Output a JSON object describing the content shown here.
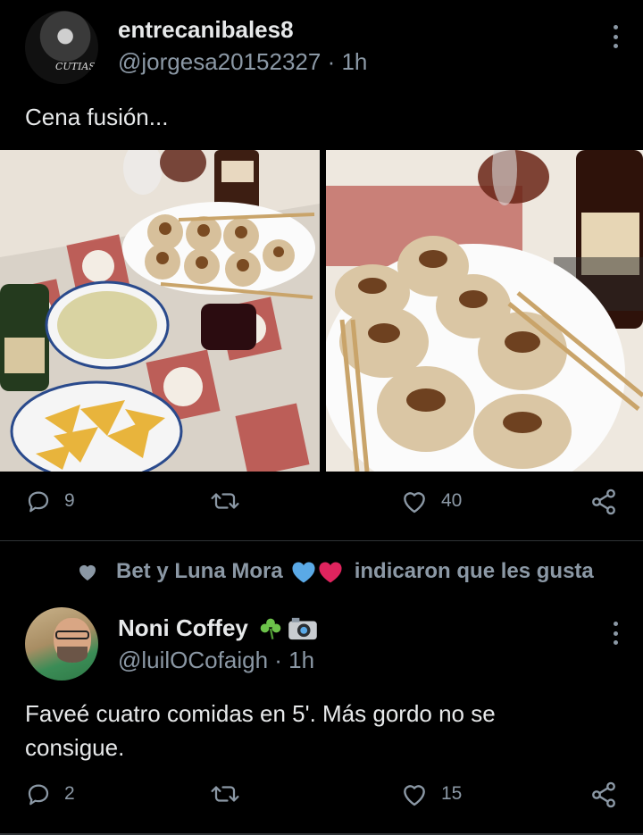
{
  "tweet1": {
    "name": "entrecanibales8",
    "handle": "@jorgesa20152327 · 1h",
    "text": "Cena fusión...",
    "avatar_text": "CUTIAS",
    "replies": "9",
    "likes": "40"
  },
  "social_context": {
    "names": "Bet y Luna Mora",
    "tail": "indicaron que les gusta"
  },
  "tweet2": {
    "name": "Noni Coffey",
    "handle": "@luilOCofaigh · 1h",
    "text_line1": "Faveé cuatro comidas en 5'. Más gordo no se",
    "text_line2": "consigue.",
    "replies": "2",
    "likes": "15"
  },
  "icons": [
    "reply-icon",
    "retweet-icon",
    "like-icon",
    "share-icon",
    "more-icon"
  ],
  "colors": {
    "background": "#000000",
    "text": "#e7e9ea",
    "muted": "#8b98a5",
    "divider": "#2f3336",
    "heart_blue": "#5aa9e6",
    "heart_red": "#e0245e",
    "shamrock": "#6cc24a"
  }
}
